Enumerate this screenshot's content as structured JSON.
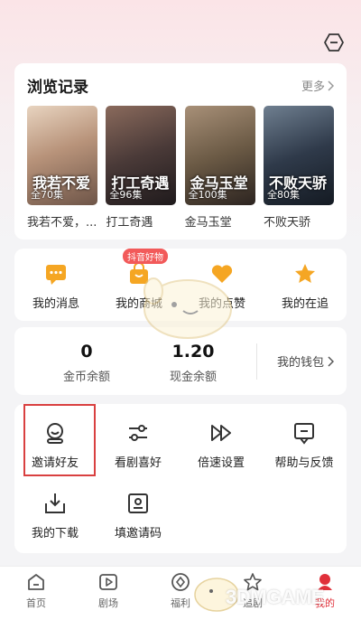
{
  "history": {
    "title": "浏览记录",
    "more": "更多",
    "items": [
      {
        "title": "我若不爱，...",
        "badge": "全70集",
        "art": "我若不爱",
        "bg": "#c9a58c"
      },
      {
        "title": "打工奇遇",
        "badge": "全96集",
        "art": "打工奇遇",
        "bg": "#5a4a4a"
      },
      {
        "title": "金马玉堂",
        "badge": "全100集",
        "art": "金马玉堂",
        "bg": "#6b5a45"
      },
      {
        "title": "不败天骄",
        "badge": "全80集",
        "art": "不败天骄",
        "bg": "#2f3a4a"
      }
    ]
  },
  "quick": {
    "shop_tag": "抖音好物",
    "items": [
      {
        "label": "我的消息",
        "icon": "message-icon"
      },
      {
        "label": "我的商城",
        "icon": "shopping-bag-icon"
      },
      {
        "label": "我的点赞",
        "icon": "heart-icon"
      },
      {
        "label": "我的在追",
        "icon": "star-icon"
      }
    ]
  },
  "wallet": {
    "coin_value": "0",
    "coin_label": "金币余额",
    "cash_value": "1.20",
    "cash_label": "现金余额",
    "link": "我的钱包"
  },
  "tools": [
    {
      "label": "邀请好友",
      "icon": "invite-friends-icon"
    },
    {
      "label": "看剧喜好",
      "icon": "preferences-icon"
    },
    {
      "label": "倍速设置",
      "icon": "playback-speed-icon"
    },
    {
      "label": "帮助与反馈",
      "icon": "help-feedback-icon"
    },
    {
      "label": "我的下载",
      "icon": "download-icon"
    },
    {
      "label": "填邀请码",
      "icon": "invite-code-icon"
    }
  ],
  "tabbar": [
    {
      "label": "首页",
      "icon": "home-icon"
    },
    {
      "label": "剧场",
      "icon": "theater-icon"
    },
    {
      "label": "福利",
      "icon": "welfare-icon"
    },
    {
      "label": "追剧",
      "icon": "follow-icon"
    },
    {
      "label": "我的",
      "icon": "profile-icon"
    }
  ],
  "watermark": "3DMGAME",
  "colors": {
    "accent": "#f5a623",
    "active": "#e0303a",
    "highlight": "#d94040"
  }
}
